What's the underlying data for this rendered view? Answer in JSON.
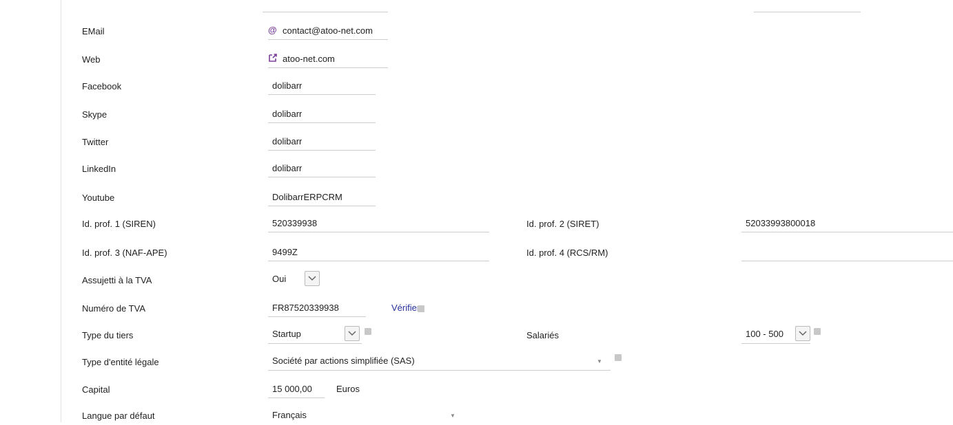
{
  "rows": {
    "email": {
      "label": "EMail",
      "value": "contact@atoo-net.com",
      "icon": "at-icon"
    },
    "web": {
      "label": "Web",
      "value": "atoo-net.com",
      "icon": "external-link-icon"
    },
    "facebook": {
      "label": "Facebook",
      "value": "dolibarr"
    },
    "skype": {
      "label": "Skype",
      "value": "dolibarr"
    },
    "twitter": {
      "label": "Twitter",
      "value": "dolibarr"
    },
    "linkedin": {
      "label": "LinkedIn",
      "value": "dolibarr"
    },
    "youtube": {
      "label": "Youtube",
      "value": "DolibarrERPCRM"
    },
    "idprof1": {
      "label": "Id. prof. 1 (SIREN)",
      "value": "520339938"
    },
    "idprof2": {
      "label": "Id. prof. 2 (SIRET)",
      "value": "52033993800018"
    },
    "idprof3": {
      "label": "Id. prof. 3 (NAF-APE)",
      "value": "9499Z"
    },
    "idprof4": {
      "label": "Id. prof. 4 (RCS/RM)",
      "value": ""
    },
    "vat_subject": {
      "label": "Assujetti à la TVA",
      "value": "Oui"
    },
    "vat_number": {
      "label": "Numéro de TVA",
      "value": "FR87520339938",
      "verify_label": "Vérifier"
    },
    "thirdparty_type": {
      "label": "Type du tiers",
      "value": "Startup"
    },
    "employees": {
      "label": "Salariés",
      "value": "100 - 500"
    },
    "legal_form": {
      "label": "Type d'entité légale",
      "value": "Société par actions simplifiée (SAS)"
    },
    "capital": {
      "label": "Capital",
      "value": "15 000,00",
      "currency": "Euros"
    },
    "language": {
      "label": "Langue par défaut",
      "value": "Français"
    }
  },
  "colors": {
    "accent": "#7b3d98",
    "link": "#26319a",
    "border": "#cccccc"
  }
}
